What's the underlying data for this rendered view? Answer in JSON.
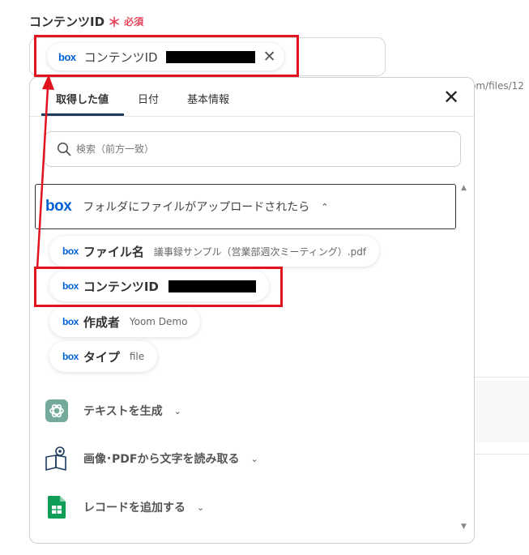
{
  "field": {
    "label": "コンテンツID",
    "required_mark": "＊",
    "required_text": "必須",
    "selected_chip": {
      "service_logo": "box",
      "label": "コンテンツID",
      "remove_icon": "close-icon"
    }
  },
  "background": {
    "url_fragment": "om/files/12"
  },
  "picker": {
    "tabs": [
      {
        "label": "取得した値",
        "active": true
      },
      {
        "label": "日付",
        "active": false
      },
      {
        "label": "基本情報",
        "active": false
      }
    ],
    "close_icon": "close-icon",
    "search_placeholder": "検索（前方一致）",
    "group": {
      "service_logo": "box",
      "title": "フォルダにファイルがアップロードされたら",
      "chevron_icon": "chevron-up-icon"
    },
    "items": [
      {
        "logo": "box",
        "label": "ファイル名",
        "value": "議事録サンプル（営業部週次ミーティング）.pdf"
      },
      {
        "logo": "box",
        "label": "コンテンツID",
        "value": "",
        "redacted": true
      },
      {
        "logo": "box",
        "label": "作成者",
        "value": "Yoom Demo"
      },
      {
        "logo": "box",
        "label": "タイプ",
        "value": "file"
      }
    ],
    "sections": [
      {
        "icon": "chatgpt-icon",
        "label": "テキストを生成",
        "chevron_icon": "chevron-down-icon"
      },
      {
        "icon": "ocr-book-icon",
        "label": "画像･PDFから文字を読み取る",
        "chevron_icon": "chevron-down-icon"
      },
      {
        "icon": "google-sheets-icon",
        "label": "レコードを追加する",
        "chevron_icon": "chevron-down-icon"
      }
    ]
  },
  "colors": {
    "required": "#e8465b",
    "box_brand": "#0061d5",
    "annotation": "#e0131e",
    "tab_underline": "#1d3c5e",
    "chatgpt": "#74aa9c",
    "sheets": "#0f9d58"
  }
}
